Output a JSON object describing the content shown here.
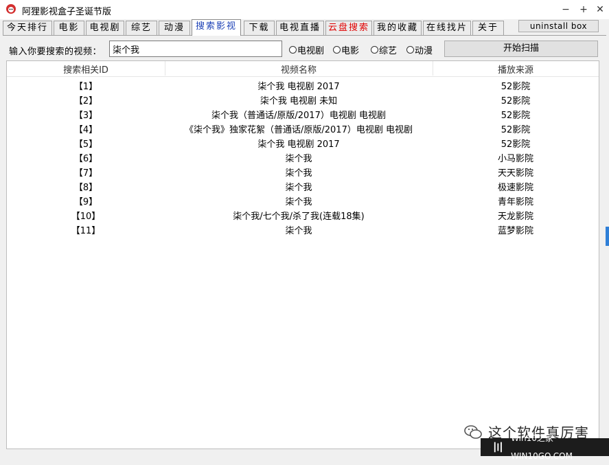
{
  "window": {
    "title": "阿狸影视盒子圣诞节版",
    "minimize": "−",
    "maximize": "+",
    "close": "✕"
  },
  "tabs": [
    {
      "label": "今天排行"
    },
    {
      "label": "电影"
    },
    {
      "label": "电视剧"
    },
    {
      "label": "综艺"
    },
    {
      "label": "动漫"
    },
    {
      "label": "搜索影视"
    },
    {
      "label": "下载"
    },
    {
      "label": "电视直播"
    },
    {
      "label": "云盘搜索"
    },
    {
      "label": "我的收藏"
    },
    {
      "label": "在线找片"
    },
    {
      "label": "关于"
    }
  ],
  "active_tab": "搜索影视",
  "uninstall_label": "uninstall box",
  "search": {
    "label": "输入你要搜索的视频：",
    "value": "柒个我",
    "radios": [
      "电视剧",
      "电影",
      "综艺",
      "动漫"
    ],
    "scan_label": "开始扫描"
  },
  "table": {
    "headers": [
      "搜索相关ID",
      "视频名称",
      "播放来源"
    ],
    "rows": [
      {
        "id": "【1】",
        "name": "柒个我 电视剧  2017",
        "source": "52影院"
      },
      {
        "id": "【2】",
        "name": "柒个我 电视剧  未知",
        "source": "52影院"
      },
      {
        "id": "【3】",
        "name": "柒个我（普通话/原版/2017）电视剧 电视剧",
        "source": "52影院"
      },
      {
        "id": "【4】",
        "name": "《柒个我》独家花絮（普通话/原版/2017）电视剧 电视剧",
        "source": "52影院"
      },
      {
        "id": "【5】",
        "name": "柒个我 电视剧  2017",
        "source": "52影院"
      },
      {
        "id": "【6】",
        "name": "柒个我",
        "source": "小马影院"
      },
      {
        "id": "【7】",
        "name": "柒个我",
        "source": "天天影院"
      },
      {
        "id": "【8】",
        "name": "柒个我",
        "source": "极速影院"
      },
      {
        "id": "【9】",
        "name": "柒个我",
        "source": "青年影院"
      },
      {
        "id": "【10】",
        "name": "柒个我/七个我/杀了我(连载18集)",
        "source": "天龙影院"
      },
      {
        "id": "【11】",
        "name": "柒个我",
        "source": "蓝梦影院"
      }
    ]
  },
  "watermark": {
    "text": "这个软件真厉害",
    "site": "Win10之家 WIN10GO.COM"
  },
  "colors": {
    "active_tab_text": "#1a3fb5",
    "cloud_tab_text": "#e00000"
  }
}
